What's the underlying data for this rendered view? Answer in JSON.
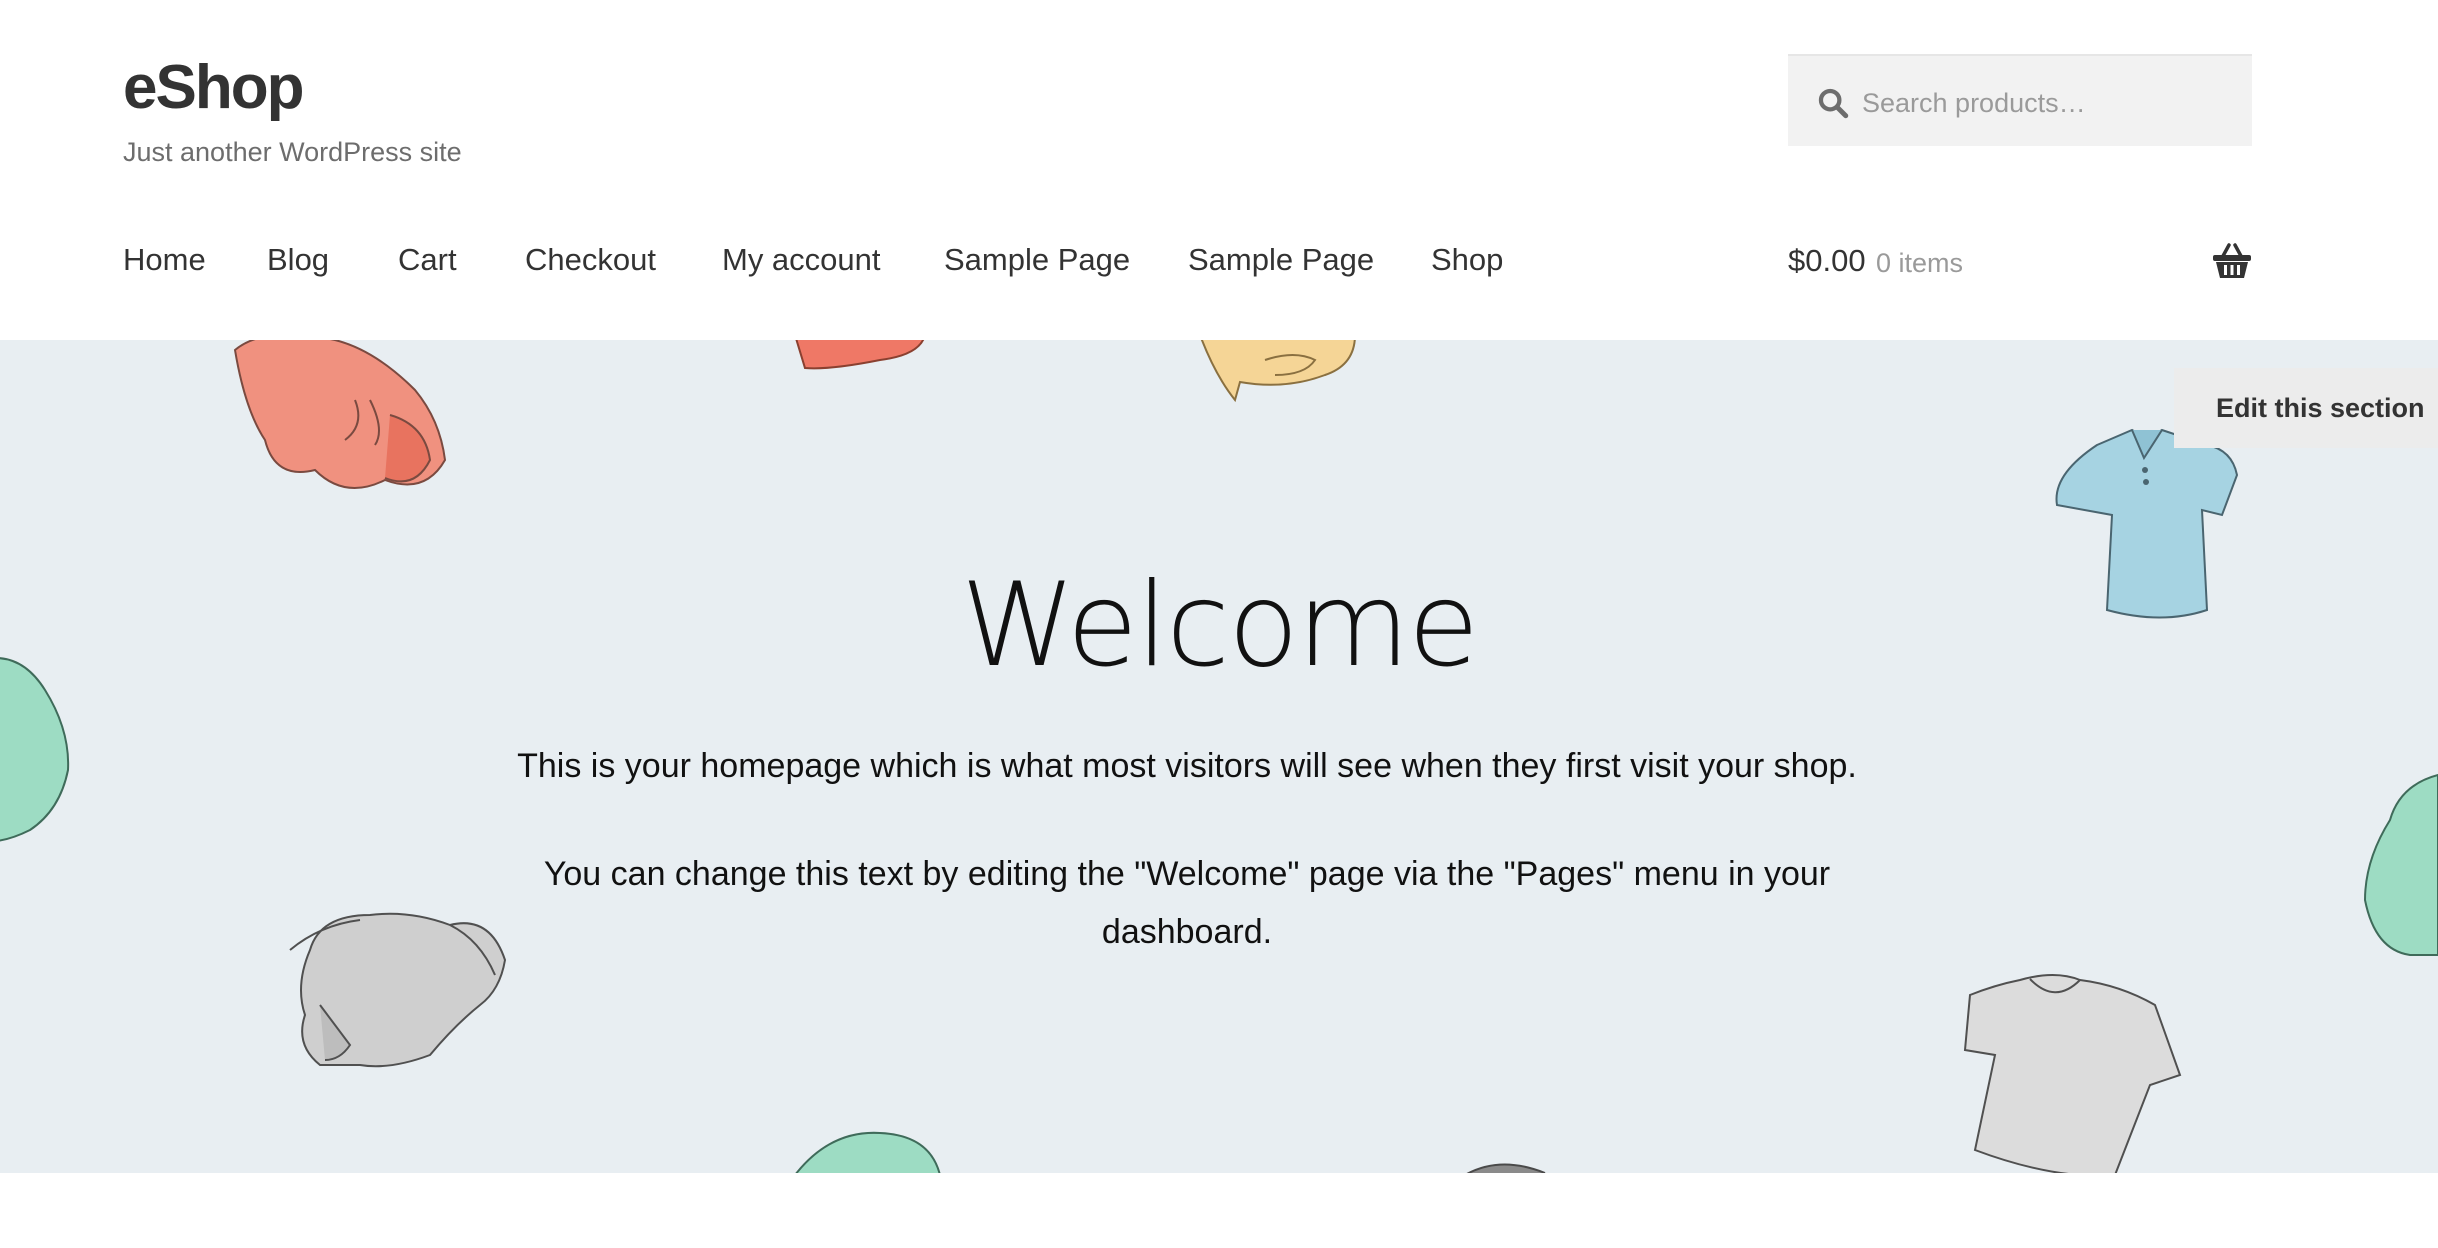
{
  "site": {
    "title": "eShop",
    "tagline": "Just another WordPress site"
  },
  "search": {
    "placeholder": "Search products…",
    "icon": "search-icon"
  },
  "nav": {
    "items": [
      {
        "label": "Home"
      },
      {
        "label": "Blog"
      },
      {
        "label": "Cart"
      },
      {
        "label": "Checkout"
      },
      {
        "label": "My account"
      },
      {
        "label": "Sample Page"
      },
      {
        "label": "Sample Page"
      },
      {
        "label": "Shop"
      }
    ]
  },
  "cart": {
    "total": "$0.00",
    "count": "0 items",
    "icon": "basket-icon"
  },
  "hero": {
    "title": "Welcome",
    "paragraph1": "This is your homepage which is what most visitors will see when they first visit your shop.",
    "paragraph2": "You can change this text by editing the \"Welcome\" page via the \"Pages\" menu in your dashboard.",
    "edit_label": "Edit this section",
    "background_color": "#e8eef2"
  },
  "colors": {
    "text": "#333333",
    "muted": "#6d6d6d",
    "search_bg": "#f2f2f2"
  }
}
